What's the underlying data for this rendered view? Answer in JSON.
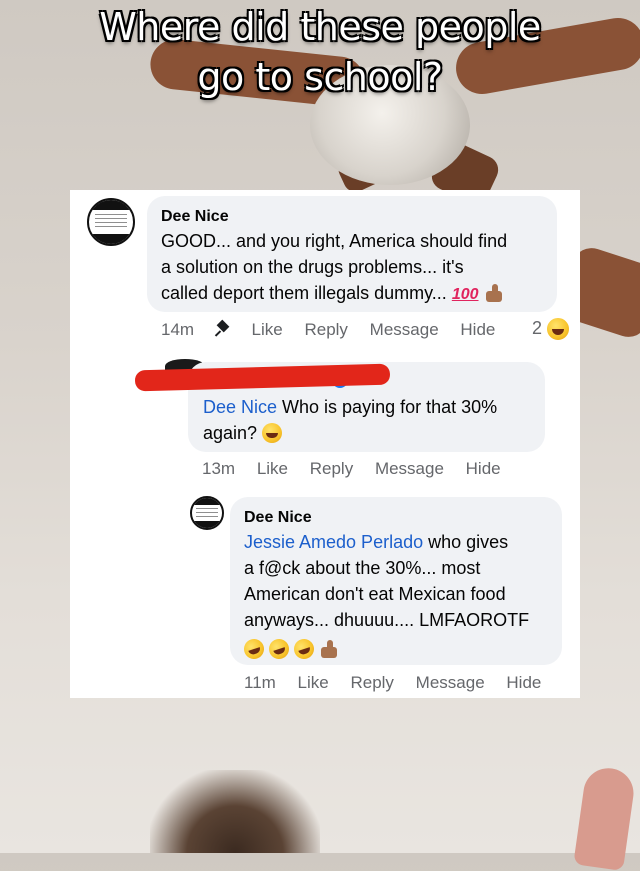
{
  "overlay": {
    "title_line1": "Where did these people",
    "title_line2": "go to school?"
  },
  "comments": [
    {
      "author": "Dee Nice",
      "text_lines": [
        "GOOD... and you right, America should find",
        "a solution on the drugs problems... it's",
        "called deport them illegals dummy..."
      ],
      "trailing_emoji": [
        "hundred-points",
        "thumbs-up"
      ],
      "time": "14m",
      "actions": [
        "Like",
        "Reply",
        "Message",
        "Hide"
      ],
      "reaction_count": "2",
      "reaction_emoji": "laughing-face"
    },
    {
      "author_visible": "do",
      "author_redacted": true,
      "verified": true,
      "mention": "Dee Nice",
      "text_after_mention": " Who is paying for that 30%",
      "text_line2": "again?",
      "trailing_emoji": [
        "tears-of-joy"
      ],
      "time": "13m",
      "actions": [
        "Like",
        "Reply",
        "Message",
        "Hide"
      ]
    },
    {
      "author": "Dee Nice",
      "mention": "Jessie Amedo Perlado",
      "text_after_mention": " who gives",
      "text_lines": [
        "a f@ck about the 30%... most",
        "American don't eat Mexican food",
        "anyways... dhuuuu.... LMFAOROTF"
      ],
      "trailing_emoji": [
        "rofl",
        "rofl",
        "rofl",
        "thumbs-up"
      ],
      "time": "11m",
      "actions": [
        "Like",
        "Reply",
        "Message",
        "Hide"
      ]
    }
  ],
  "colors": {
    "link": "#1c5fcc",
    "bubble": "#f0f2f5",
    "meta": "#65676b",
    "redaction": "#e2261a"
  }
}
